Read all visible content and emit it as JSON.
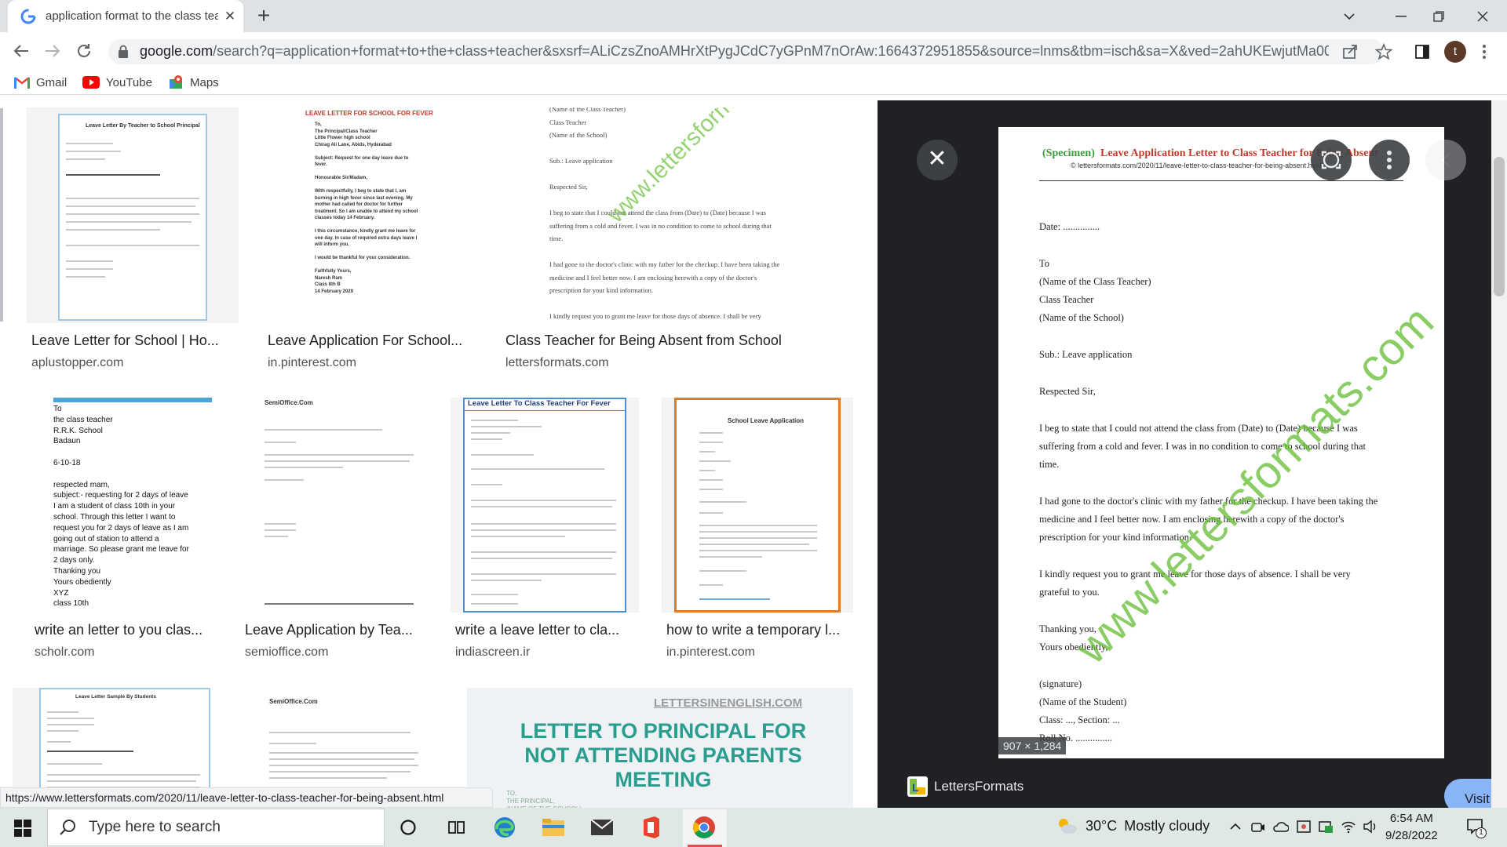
{
  "browser": {
    "tab_title": "application format to the class teacher",
    "tab_close": "✕",
    "new_tab": "+",
    "url_domain": "google.com",
    "url_rest": "/search?q=application+format+to+the+class+teacher&sxsrf=ALiCzsZnoAMHrXtPygJCdC7yGPnM7nOrAw:1664372951855&source=lnms&tbm=isch&sa=X&ved=2ahUKEwjutMa00Lf6...",
    "avatar_letter": "t",
    "bookmarks": [
      {
        "label": "Gmail",
        "icon": "gmail-icon"
      },
      {
        "label": "YouTube",
        "icon": "youtube-icon"
      },
      {
        "label": "Maps",
        "icon": "maps-icon"
      }
    ],
    "status_url": "https://www.lettersformats.com/2020/11/leave-letter-to-class-teacher-for-being-absent.html"
  },
  "results": {
    "row1": [
      {
        "title": "Leave Letter for School | Ho...",
        "source": "aplustopper.com"
      },
      {
        "title": "Leave Application For School...",
        "source": "in.pinterest.com"
      },
      {
        "title": "Class Teacher for Being Absent from School",
        "source": "lettersformats.com"
      }
    ],
    "row2": [
      {
        "title": "write an letter to you clas...",
        "source": "scholr.com"
      },
      {
        "title": "Leave Application by Tea...",
        "source": "semioffice.com"
      },
      {
        "title": "write a leave letter to cla...",
        "source": "indiascreen.ir"
      },
      {
        "title": "how to write a temporary l...",
        "source": "in.pinterest.com"
      }
    ],
    "thumb_texts": {
      "t1_heading": "Leave Letter By Teacher to School Principal",
      "t2_heading": "LEAVE LETTER FOR SCHOOL FOR FEVER",
      "t2_body": "To,\nThe Principal/Class Teacher\nLittle Flower high school\nChirag Ali Lane, Abids, Hyderabad\n\nSubject: Request for one day leave due to\nfever.\n\nHonourable Sir/Madam,\n\nWith respectfully, I beg to state that I, am\nburning in high fever since last evening. My\nmother had called for doctor for further\ntreatment. So I am unable to attend my school\nclasses today 14 February.\n\nI this circumstance, kindly grant me leave for\none day. In case of required extra days leave I\nwill inform you.\n\nI would be thankful for your consideration.\n\nFaithfully Yours,\nNaresh Ram\nClass 8th B\n14 February 2020",
      "t3_body": "(Name of the Class Teacher)\nClass Teacher\n(Name of the School)\n\nSub.: Leave application\n\nRespected Sir,\n\nI beg to state that I could not attend the class from (Date) to (Date) because I was\nsuffering from a cold and fever. I was in no condition to come to school during that\ntime.\n\nI had gone to the doctor's clinic with my father for the checkup. I have been taking the\nmedicine and I feel better now. I am enclosing herewith a copy of the doctor's\nprescription for your kind information.\n\nI kindly request you to grant me leave for those days of absence. I shall be very",
      "t4_body": "To\nthe class teacher\nR.R.K. School\nBadaun\n\n6-10-18\n\nrespected mam,\nsubject:- requesting for 2 days of leave\nI am a student of class 10th in your\nschool. Through this letter I want to\nrequest you for 2 days of leave as I am\ngoing out of station to attend a\nmarriage. So please grant me leave for\n2 days only.\nThanking you\nYours obediently\nXYZ\nclass 10th",
      "t5_heading": "SemiOffice.Com",
      "t6_heading": "Leave Letter To Class Teacher For Fever",
      "t7_heading": "School Leave Application",
      "t8_heading": "Leave Letter Sample By Students",
      "t9_heading": "SemiOffice.Com",
      "t10_site": "LETTERSINENGLISH.COM",
      "t10_title": "LETTER TO PRINCIPAL FOR NOT ATTENDING PARENTS MEETING",
      "t10_to": "TO,\nTHE PRINCIPAL,\n(NAME OF THE SCHOOL)"
    }
  },
  "preview": {
    "specimen": "(Specimen)",
    "heading": "Leave Application Letter to Class Teacher for Being Absent",
    "source_line": "© lettersformats.com/2020/11/leave-letter-to-class-teacher-for-being-absent.html",
    "lines": [
      "Date: ...............",
      "To",
      "(Name of the Class Teacher)",
      "Class Teacher",
      "(Name of the School)",
      "Sub.: Leave application",
      "Respected Sir,",
      "I beg to state that I could not attend the class from (Date) to (Date) because I was",
      "suffering from a cold and fever. I was in no condition to come to school during that",
      "time.",
      "I had gone to the doctor's clinic with my father for the checkup. I have been taking the",
      "medicine and I feel better now. I am enclosing herewith a copy of the doctor's",
      "prescription for your kind information.",
      "I kindly request you to grant me leave for those days of absence. I shall be very",
      "grateful to you.",
      "Thanking you,",
      "Yours obediently,",
      "(signature)",
      "(Name of the Student)",
      "Class: ..., Section: ...",
      "Roll No. ..............."
    ],
    "watermark": "www.lettersformats.com",
    "dimensions": "907 × 1,284",
    "site_name": "LettersFormats",
    "visit_label": "Visit",
    "close": "✕"
  },
  "taskbar": {
    "search_placeholder": "Type here to search",
    "temperature": "30°C",
    "weather": "Mostly cloudy",
    "time": "6:54 AM",
    "date": "9/28/2022",
    "notification_count": "1"
  },
  "colors": {
    "tabstrip": "#dee1e6",
    "accent_red": "#c0392b",
    "watermark_green": "#6abf3a",
    "orange_border": "#e07b2a",
    "blue_border": "#4a90d9"
  }
}
